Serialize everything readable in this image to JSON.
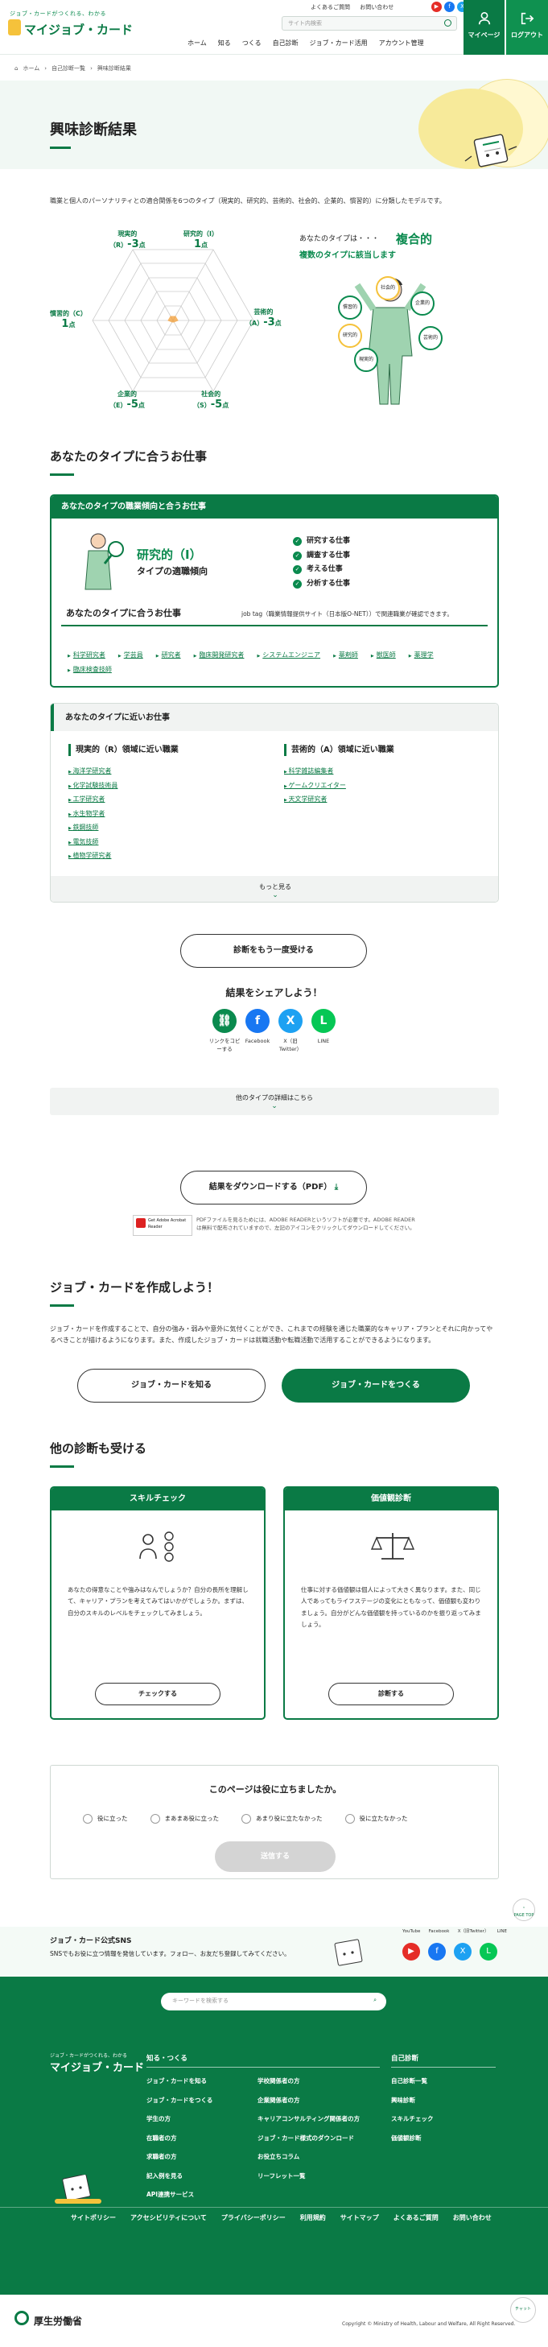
{
  "header": {
    "logo_sub": "ジョブ・カードがつくれる、わかる",
    "logo_main": "マイジョブ・カード",
    "toplinks": [
      "よくあるご質問",
      "お問い合わせ"
    ],
    "search_placeholder": "サイト内検索",
    "nav": [
      "ホーム",
      "知る",
      "つくる",
      "自己診断",
      "ジョブ・カード活用",
      "アカウント管理"
    ],
    "mypage": "マイページ",
    "logout": "ログアウト"
  },
  "breadcrumb": [
    "ホーム",
    "自己診断一覧",
    "興味診断結果"
  ],
  "page_title": "興味診断結果",
  "intro": "職業と個人のパーソナリティとの適合関係を6つのタイプ（現実的、研究的、芸術的、社会的、企業的、慣習的）に分類したモデルです。",
  "radar": {
    "labels": [
      {
        "name": "研究的（I）",
        "score": "1",
        "unit": "点"
      },
      {
        "name": "芸術的",
        "abbr": "（A）",
        "score": "-3",
        "unit": "点"
      },
      {
        "name": "社会的",
        "abbr": "（S）",
        "score": "-5",
        "unit": "点"
      },
      {
        "name": "企業的",
        "abbr": "（E）",
        "score": "-5",
        "unit": "点"
      },
      {
        "name": "慣習的（C）",
        "score": "1",
        "unit": "点"
      },
      {
        "name": "現実的",
        "abbr": "（R）",
        "score": "-3",
        "unit": "点"
      }
    ]
  },
  "result": {
    "intro": "あなたのタイプは・・・",
    "type": "複合的",
    "sub": "複数のタイプに該当します",
    "bubbles": [
      "社会的",
      "企業的",
      "慣習的",
      "研究的",
      "芸術的",
      "現実的"
    ]
  },
  "sec1_title": "あなたのタイプに合うお仕事",
  "card1": {
    "header": "あなたのタイプの職業傾向と合うお仕事",
    "tendency": "研究的（I）",
    "tendency_sub": "タイプの適職傾向",
    "checks": [
      "研究する仕事",
      "調査する仕事",
      "考える仕事",
      "分析する仕事"
    ],
    "jobs_heading": "あなたのタイプに合うお仕事",
    "jobs_note": "job tag（職業情報提供サイト（日本版O-NET））で関連職業が確認できます。",
    "jobs": [
      "科学研究者",
      "学芸員",
      "研究者",
      "臨床開発研究者",
      "システムエンジニア",
      "薬剤師",
      "獣医師",
      "薬理学",
      "臨床検査技師"
    ]
  },
  "card2": {
    "header": "あなたのタイプに近いお仕事",
    "left_title": "現実的（R）領域に近い職業",
    "left": [
      "海洋学研究者",
      "化学試験技術員",
      "工学研究者",
      "水生物学者",
      "鉄鋼技師",
      "電気技師",
      "植物学研究者"
    ],
    "right_title": "芸術的（A）領域に近い職業",
    "right": [
      "科学雑誌編集者",
      "ゲームクリエイター",
      "天文学研究者"
    ],
    "more": "もっと見る"
  },
  "retake": "診断をもう一度受ける",
  "share": {
    "title": "結果をシェアしよう！",
    "items": [
      {
        "icon": "⛓",
        "label": "リンクをコピーする",
        "color": "#0a8a4e"
      },
      {
        "icon": "f",
        "label": "Facebook",
        "color": "#1877f2"
      },
      {
        "icon": "X",
        "label": "X（旧Twitter）",
        "color": "#1da1f2"
      },
      {
        "icon": "L",
        "label": "LINE",
        "color": "#06c755"
      }
    ]
  },
  "detail_bar": "他のタイプの詳細はこちら",
  "pdf": {
    "button": "結果をダウンロードする（PDF）",
    "badge": "Get Adobe Acrobat Reader",
    "note": "PDFファイルを見るためには、ADOBE READERというソフトが必要です。ADOBE READERは無料で配布されていますので、左記のアイコンをクリックしてダウンロードしてください。"
  },
  "jobcard": {
    "title": "ジョブ・カードを作成しよう！",
    "desc": "ジョブ・カードを作成することで、自分の強み・弱みや意外に気付くことができ、これまでの経験を通じた職業的なキャリア・プランとそれに向かってやるべきことが描けるようになります。また、作成したジョブ・カードは就職活動や転職活動で活用することができるようになります。",
    "btn_know": "ジョブ・カードを知る",
    "btn_make": "ジョブ・カードをつくる"
  },
  "other": {
    "title": "他の診断も受ける",
    "cards": [
      {
        "title": "スキルチェック",
        "body": "あなたの得意なことや強みはなんでしょうか？自分の長所を理解して、キャリア・プランを考えてみてはいかがでしょうか。まずは、自分のスキルのレベルをチェックしてみましょう。",
        "btn": "チェックする"
      },
      {
        "title": "価値観診断",
        "body": "仕事に対する価値観は個人によって大きく異なります。また、同じ人であってもライフステージの変化にともなって、価値観も変わりましょう。自分がどんな価値観を持っているのかを振り返ってみましょう。",
        "btn": "診断する"
      }
    ]
  },
  "feedback": {
    "title": "このページは役に立ちましたか。",
    "options": [
      "役に立った",
      "まあまあ役に立った",
      "あまり役に立たなかった",
      "役に立たなかった"
    ],
    "send": "送信する"
  },
  "pagetop": "PAGE TOP",
  "snsband": {
    "title": "ジョブ・カード公式SNS",
    "desc": "SNSでもお役に立つ情報を発信しています。フォロー、お友だち登録してみてください。",
    "labels": [
      "YouTube",
      "Facebook",
      "X（旧Twitter）",
      "LINE"
    ]
  },
  "footer": {
    "search_placeholder": "キーワードを検索する",
    "logo_sub": "ジョブ・カードがつくれる、わかる",
    "logo_main": "マイジョブ・カード",
    "col_head_1": "知る・つくる",
    "col_head_2": "自己診断",
    "col1": [
      "ジョブ・カードを知る",
      "ジョブ・カードをつくる",
      "学生の方",
      "在職者の方",
      "求職者の方",
      "記入例を見る",
      "API連携サービス"
    ],
    "col2": [
      "学校関係者の方",
      "企業関係者の方",
      "キャリアコンサルティング関係者の方",
      "ジョブ・カード様式のダウンロード",
      "お役立ちコラム",
      "リーフレット一覧"
    ],
    "col3": [
      "自己診断一覧",
      "興味診断",
      "スキルチェック",
      "価値観診断"
    ],
    "bottom_nav": [
      "サイトポリシー",
      "アクセシビリティについて",
      "プライバシーポリシー",
      "利用規約",
      "サイトマップ",
      "よくあるご質問",
      "お問い合わせ"
    ],
    "ministry": "厚生労働省",
    "copyright": "Copyright © Ministry of Health, Labour and Welfare, All Right Reserved.",
    "chat": "チャット"
  }
}
